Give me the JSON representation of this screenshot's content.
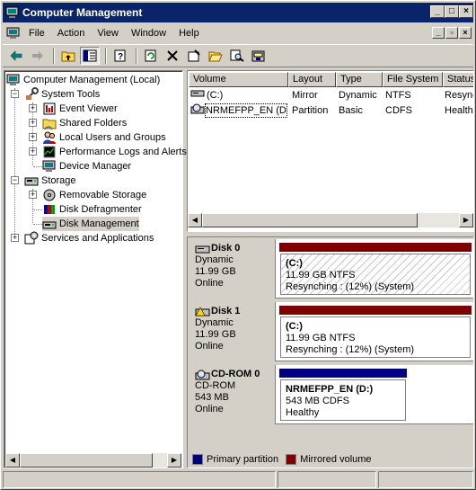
{
  "window": {
    "title": "Computer Management"
  },
  "menu": {
    "items": [
      "File",
      "Action",
      "View",
      "Window",
      "Help"
    ]
  },
  "tree": {
    "nodes": [
      "Computer Management (Local)",
      "System Tools",
      "Event Viewer",
      "Shared Folders",
      "Local Users and Groups",
      "Performance Logs and Alerts",
      "Device Manager",
      "Storage",
      "Removable Storage",
      "Disk Defragmenter",
      "Disk Management",
      "Services and Applications"
    ]
  },
  "volumes": {
    "columns": [
      "Volume",
      "Layout",
      "Type",
      "File System",
      "Status"
    ],
    "rows": [
      {
        "volume": "(C:)",
        "layout": "Mirror",
        "type": "Dynamic",
        "fs": "NTFS",
        "status": "Resync"
      },
      {
        "volume": "NRMEFPP_EN (D:)",
        "layout": "Partition",
        "type": "Basic",
        "fs": "CDFS",
        "status": "Healthy"
      }
    ]
  },
  "disks": [
    {
      "name": "Disk 0",
      "type": "Dynamic",
      "size": "11.99 GB",
      "state": "Online",
      "part_name": "(C:)",
      "part_size": "11.99 GB NTFS",
      "part_status": "Resynching : (12%) (System)",
      "color": "#800000"
    },
    {
      "name": "Disk 1",
      "type": "Dynamic",
      "size": "11.99 GB",
      "state": "Online",
      "part_name": "(C:)",
      "part_size": "11.99 GB NTFS",
      "part_status": "Resynching : (12%) (System)",
      "color": "#800000"
    },
    {
      "name": "CD-ROM 0",
      "type": "CD-ROM",
      "size": "543 MB",
      "state": "Online",
      "part_name": "NRMEFPP_EN  (D:)",
      "part_size": "543 MB CDFS",
      "part_status": "Healthy",
      "color": "#000080"
    }
  ],
  "legend": {
    "primary": "Primary partition",
    "mirrored": "Mirrored volume",
    "primary_color": "#000080",
    "mirrored_color": "#800000"
  }
}
